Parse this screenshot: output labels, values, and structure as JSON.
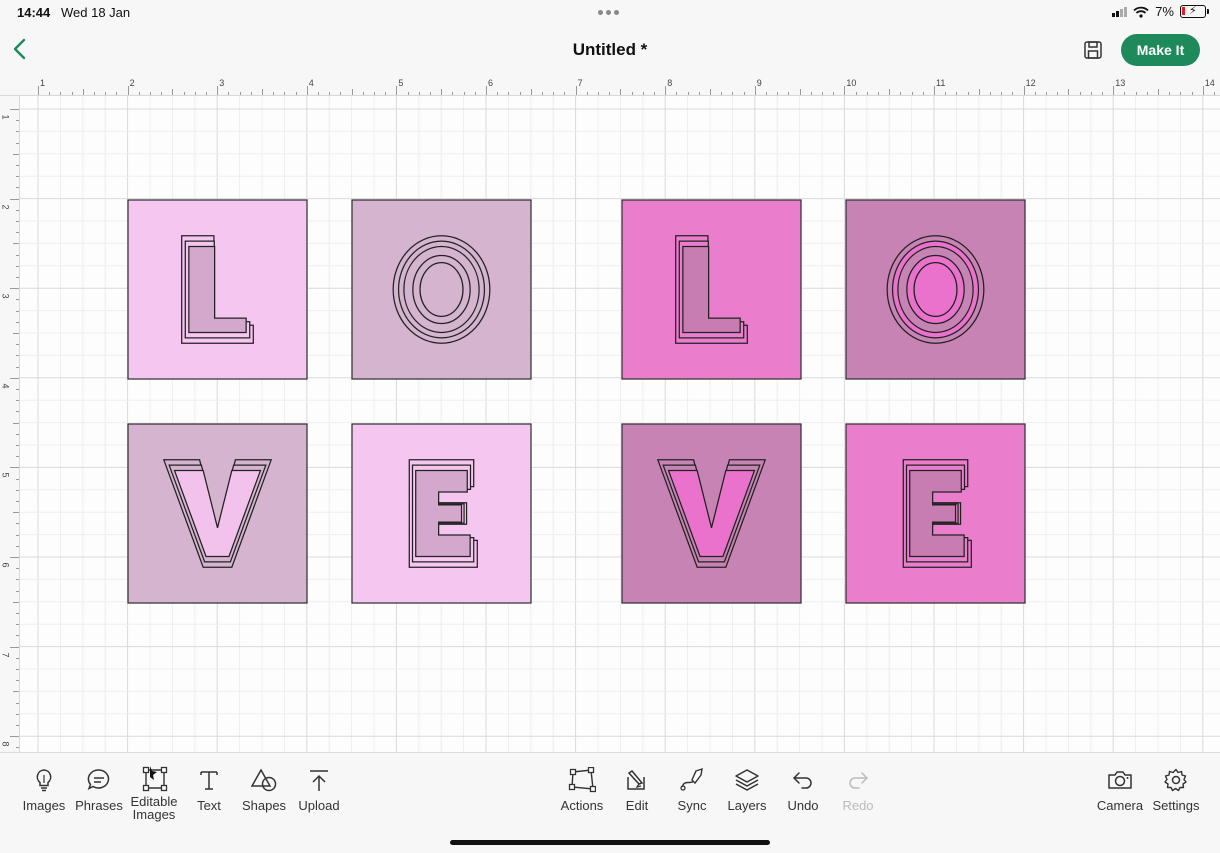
{
  "status": {
    "time": "14:44",
    "date": "Wed 18 Jan",
    "battery": "7%"
  },
  "header": {
    "title": "Untitled *",
    "make_it_label": "Make It",
    "back_icon": "chevron-left-icon",
    "save_icon": "save-icon"
  },
  "rulers": {
    "top": [
      "1",
      "2",
      "3",
      "4",
      "5",
      "6",
      "7",
      "8",
      "9",
      "10",
      "11",
      "12",
      "13",
      "14"
    ],
    "left": [
      "1",
      "2",
      "3",
      "4",
      "5",
      "6",
      "7",
      "8"
    ]
  },
  "canvas": {
    "tiles": [
      {
        "letter": "L",
        "bg": "#f5c6f0",
        "fill": "#d4a8cc"
      },
      {
        "letter": "O",
        "bg": "#d4b4ce",
        "fill": "#d4b4ce"
      },
      {
        "letter": "L",
        "bg": "#ea7ecd",
        "fill": "#c77db2"
      },
      {
        "letter": "O",
        "bg": "#c683b3",
        "fill": "#ea72cc"
      },
      {
        "letter": "V",
        "bg": "#d4b4ce",
        "fill": "#f2c2ec"
      },
      {
        "letter": "E",
        "bg": "#f5c6f0",
        "fill": "#d4a8cc"
      },
      {
        "letter": "V",
        "bg": "#c683b3",
        "fill": "#ea72cc"
      },
      {
        "letter": "E",
        "bg": "#ea7ecd",
        "fill": "#c77db2"
      }
    ]
  },
  "toolbar": {
    "left": [
      {
        "label": "Images",
        "icon": "lightbulb-icon"
      },
      {
        "label": "Phrases",
        "icon": "speech-bubble-icon"
      },
      {
        "label": "Editable Images",
        "icon": "editable-image-icon"
      },
      {
        "label": "Text",
        "icon": "text-icon"
      },
      {
        "label": "Shapes",
        "icon": "shapes-icon"
      },
      {
        "label": "Upload",
        "icon": "upload-icon"
      }
    ],
    "center": [
      {
        "label": "Actions",
        "icon": "actions-icon"
      },
      {
        "label": "Edit",
        "icon": "edit-icon"
      },
      {
        "label": "Sync",
        "icon": "sync-icon"
      },
      {
        "label": "Layers",
        "icon": "layers-icon"
      },
      {
        "label": "Undo",
        "icon": "undo-icon"
      },
      {
        "label": "Redo",
        "icon": "redo-icon"
      }
    ],
    "right": [
      {
        "label": "Camera",
        "icon": "camera-icon"
      },
      {
        "label": "Settings",
        "icon": "gear-icon"
      }
    ]
  }
}
